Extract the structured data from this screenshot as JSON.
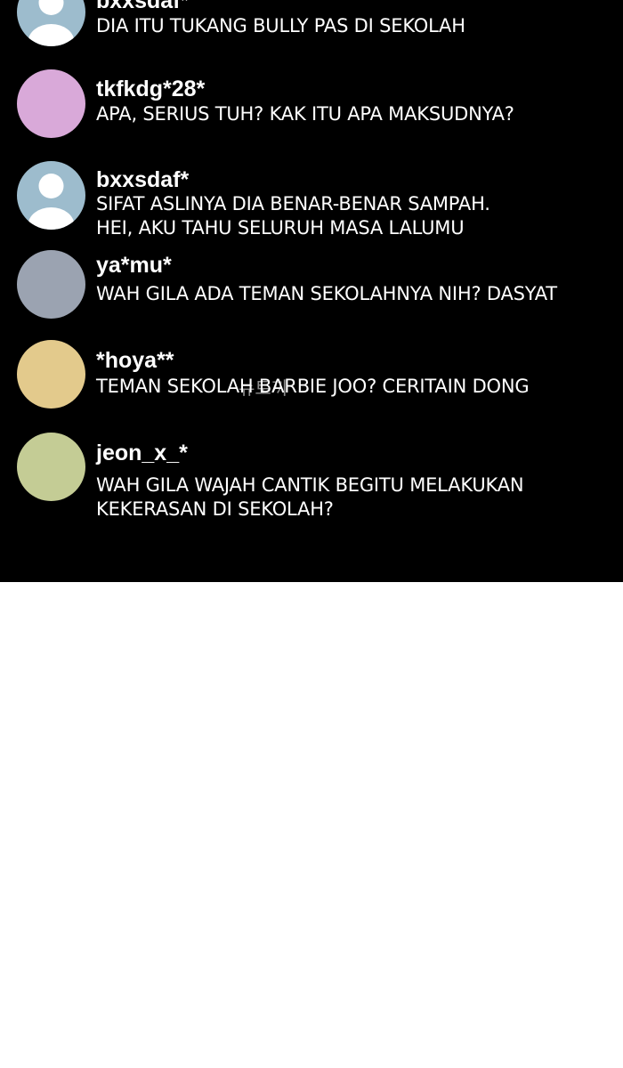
{
  "comments": [
    {
      "username": "bxxsdaf*",
      "avatar_type": "default-person",
      "avatar_color": "#9dbccd",
      "lines": [
        "DIA ITU TUKANG BULLY PAS DI SEKOLAH"
      ]
    },
    {
      "username": "tkfkdg*28*",
      "avatar_type": "solid",
      "avatar_color": "#d9a9d9",
      "lines": [
        "APA, SERIUS TUH? KAK ITU APA MAKSUDNYA?"
      ]
    },
    {
      "username": "bxxsdaf*",
      "avatar_type": "default-person",
      "avatar_color": "#9dbccd",
      "lines": [
        "SIFAT ASLINYA DIA BENAR-BENAR SAMPAH.",
        "HEI, AKU TAHU SELURUH MASA LALUMU"
      ]
    },
    {
      "username": "ya*mu*",
      "avatar_type": "solid",
      "avatar_color": "#9ba3b1",
      "lines": [
        "WAH GILA ADA TEMAN SEKOLAHNYA NIH? DASYAT"
      ]
    },
    {
      "username": "*hoya**",
      "avatar_type": "solid",
      "avatar_color": "#e3ca8c",
      "lines": [
        "TEMAN SEKOLAH BARBIE JOO? CERITAIN DONG"
      ]
    },
    {
      "username": "jeon_x_*",
      "avatar_type": "solid",
      "avatar_color": "#c4cc95",
      "lines": [
        "WAH GILA WAJAH CANTIK BEGITU MELAKUKAN",
        "KEKERASAN DI SEKOLAH?"
      ]
    }
  ],
  "watermark": "뉴토끼"
}
